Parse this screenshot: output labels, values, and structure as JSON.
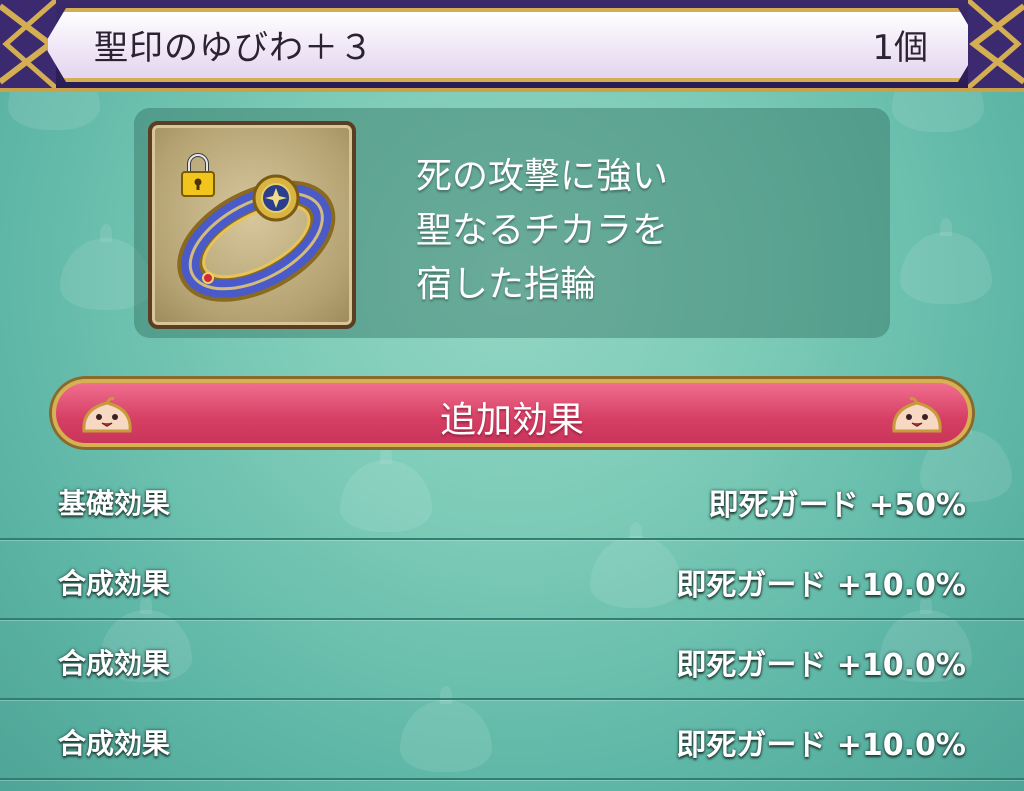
{
  "header": {
    "item_name": "聖印のゆびわ＋３",
    "count": "1個"
  },
  "item": {
    "icon": "ring-icon",
    "locked": true,
    "description": [
      "死の攻撃に強い",
      "聖なるチカラを",
      "宿した指輪"
    ]
  },
  "section": {
    "title": "追加効果"
  },
  "effects": [
    {
      "label": "基礎効果",
      "value": "即死ガード +50%"
    },
    {
      "label": "合成効果",
      "value": "即死ガード +10.0%"
    },
    {
      "label": "合成効果",
      "value": "即死ガード +10.0%"
    },
    {
      "label": "合成効果",
      "value": "即死ガード +10.0%"
    }
  ],
  "colors": {
    "background": "#7ccbb7",
    "header": "#2a1c54",
    "gold": "#d4ae52",
    "banner": "#d63f64"
  }
}
